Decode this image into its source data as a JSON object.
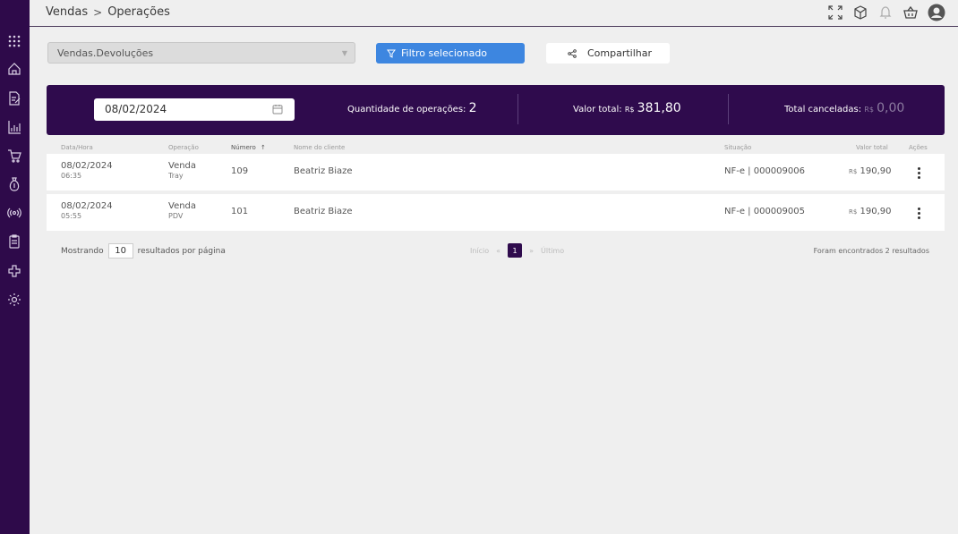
{
  "breadcrumb": {
    "parent": "Vendas",
    "separator": ">",
    "current": "Operações"
  },
  "top_icons": [
    "expand-icon",
    "cube-icon",
    "bell-icon",
    "basket-icon",
    "user-icon"
  ],
  "sidebar": {
    "icons": [
      "apps-grid-icon",
      "home-icon",
      "document-edit-icon",
      "chart-icon",
      "cart-icon",
      "money-bag-icon",
      "broadcast-icon",
      "clipboard-icon",
      "puzzle-icon",
      "settings-icon"
    ]
  },
  "toolbar": {
    "report": "Vendas.Devoluções",
    "filter_label": "Filtro selecionado",
    "share_label": "Compartilhar"
  },
  "summary": {
    "date": "08/02/2024",
    "qty_label": "Quantidade de operações:",
    "qty_value": "2",
    "total_label": "Valor total:",
    "total_currency": "R$",
    "total_value": "381,80",
    "cancel_label": "Total canceladas:",
    "cancel_currency": "R$",
    "cancel_value": "0,00"
  },
  "table": {
    "headers": {
      "datetime": "Data/Hora",
      "operation": "Operação",
      "number": "Número",
      "client": "Nome do cliente",
      "status": "Situação",
      "total": "Valor total",
      "actions": "Ações"
    },
    "sort_indicator": "↑",
    "rows": [
      {
        "date": "08/02/2024",
        "time": "06:35",
        "op": "Venda",
        "channel": "Tray",
        "number": "109",
        "client": "Beatriz Biaze",
        "status": "NF-e | 000009006",
        "currency": "R$",
        "value": "190,90"
      },
      {
        "date": "08/02/2024",
        "time": "05:55",
        "op": "Venda",
        "channel": "PDV",
        "number": "101",
        "client": "Beatriz Biaze",
        "status": "NF-e | 000009005",
        "currency": "R$",
        "value": "190,90"
      }
    ]
  },
  "footer": {
    "showing": "Mostrando",
    "page_size": "10",
    "per_page": "resultados por página",
    "first": "Início",
    "prev": "«",
    "current_page": "1",
    "next": "»",
    "last": "Último",
    "found": "Foram encontrados 2 resultados"
  },
  "colors": {
    "sidebar": "#2e0a4a",
    "summary": "#2f0b4d",
    "accent": "#3d86e0"
  }
}
